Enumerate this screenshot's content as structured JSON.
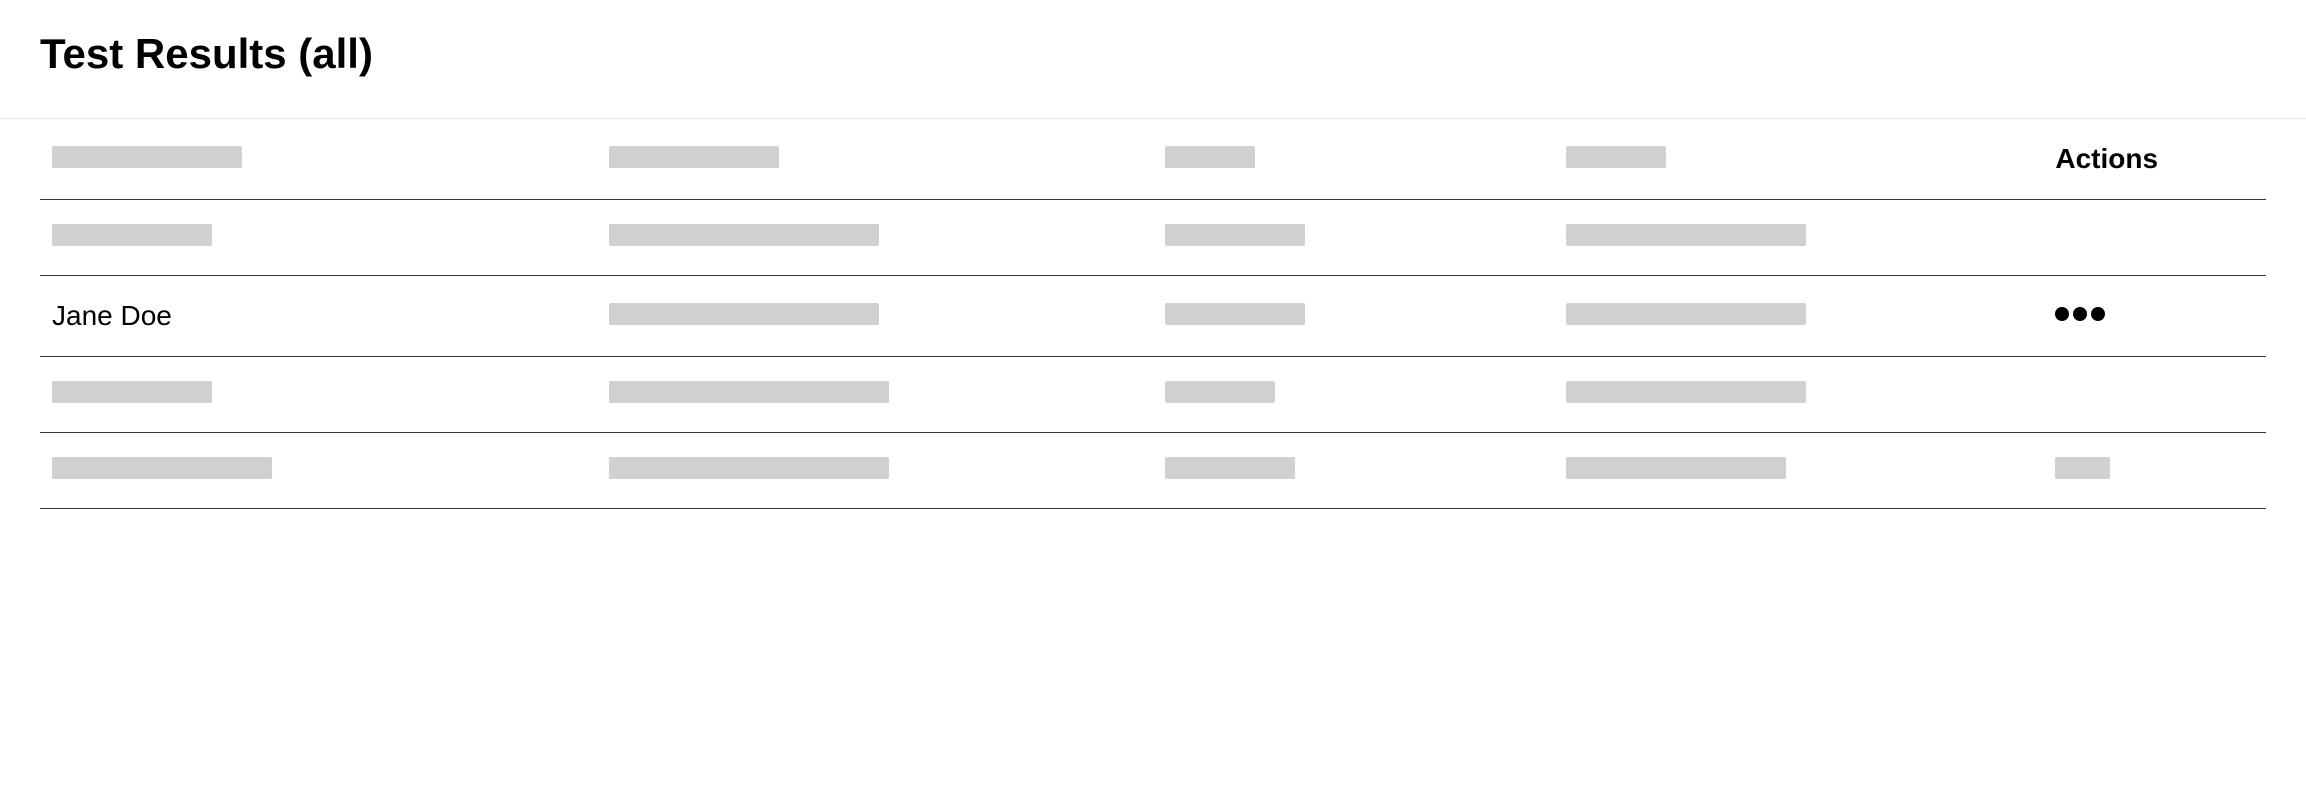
{
  "header": {
    "title": "Test Results (all)"
  },
  "table": {
    "actions_header": "Actions",
    "rows": [
      {
        "name": "Jane Doe"
      }
    ]
  }
}
